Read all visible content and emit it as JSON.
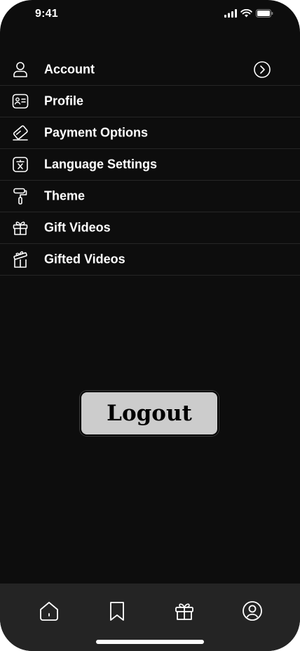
{
  "status_bar": {
    "time": "9:41"
  },
  "menu": {
    "items": [
      {
        "label": "Account",
        "icon": "user-icon"
      },
      {
        "label": "Profile",
        "icon": "id-card-icon"
      },
      {
        "label": "Payment Options",
        "icon": "card-icon"
      },
      {
        "label": "Language Settings",
        "icon": "translate-icon"
      },
      {
        "label": "Theme",
        "icon": "paint-roller-icon"
      },
      {
        "label": "Gift Videos",
        "icon": "gift-icon"
      },
      {
        "label": "Gifted Videos",
        "icon": "gifted-icon"
      }
    ]
  },
  "logout": {
    "label": "Logout"
  },
  "tab_bar": {
    "tabs": [
      {
        "icon": "home-icon"
      },
      {
        "icon": "bookmark-icon"
      },
      {
        "icon": "gift-icon"
      },
      {
        "icon": "profile-icon"
      }
    ]
  },
  "colors": {
    "background": "#0d0d0d",
    "tab_bar": "#242424",
    "button": "#cccccc",
    "text": "#ffffff"
  }
}
